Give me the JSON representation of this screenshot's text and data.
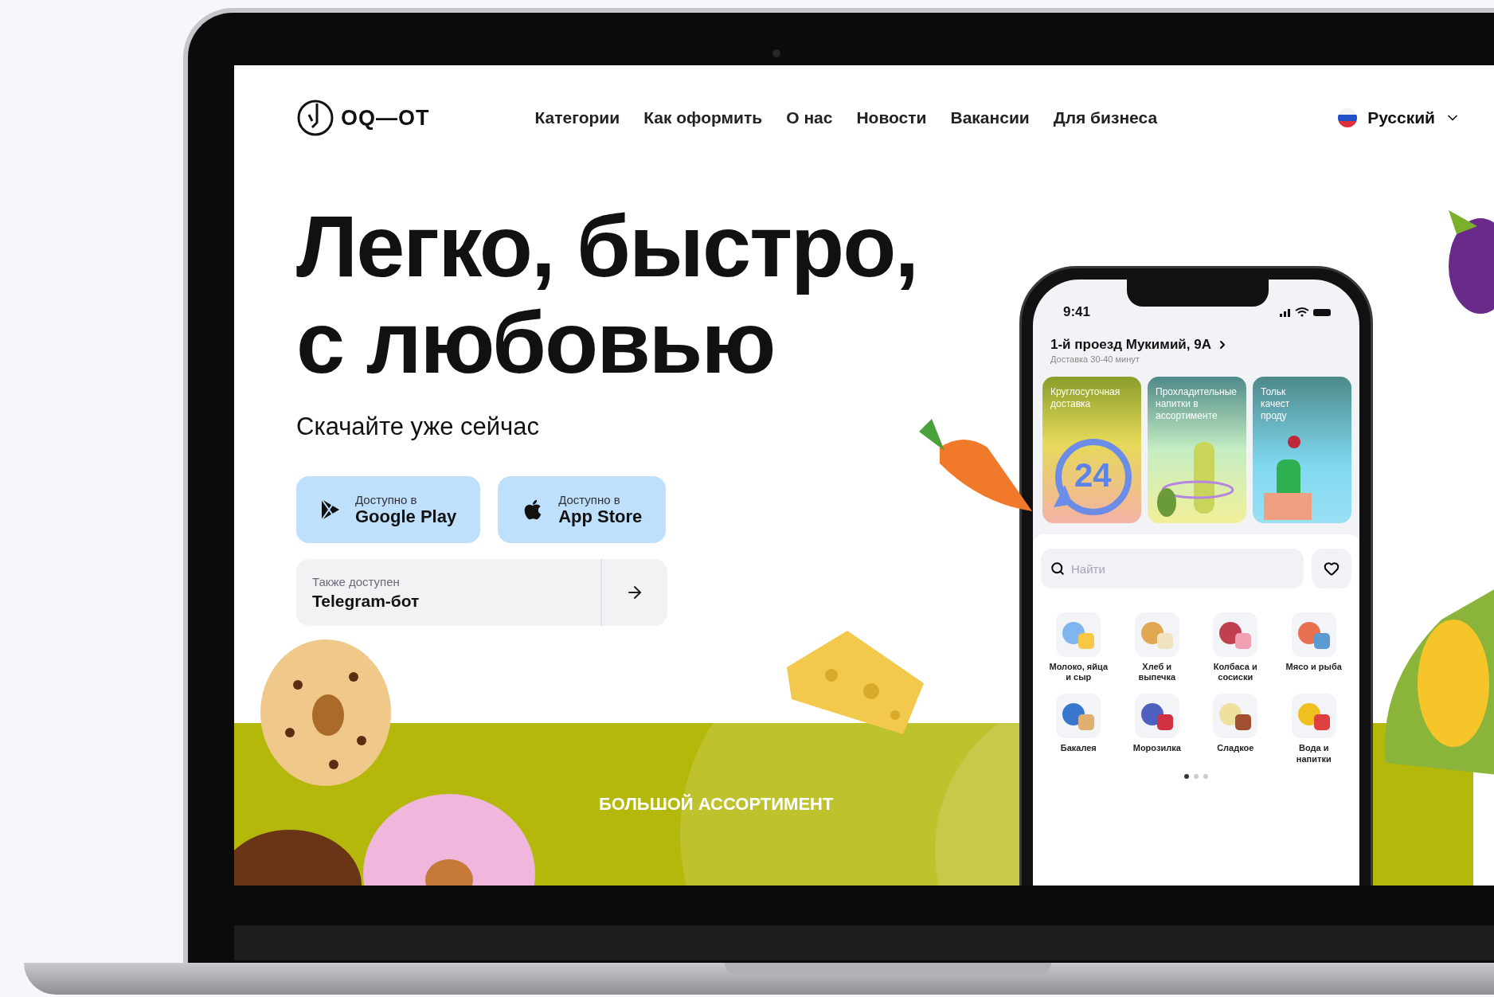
{
  "logo": {
    "text": "OQ—OT"
  },
  "nav": [
    {
      "label": "Категории"
    },
    {
      "label": "Как оформить"
    },
    {
      "label": "О нас"
    },
    {
      "label": "Новости"
    },
    {
      "label": "Вакансии"
    },
    {
      "label": "Для бизнеса"
    }
  ],
  "language": {
    "label": "Русский"
  },
  "hero": {
    "title_lines": [
      "Легко, быстро,",
      "с любовью"
    ],
    "subtitle": "Скачайте уже сейчас"
  },
  "store_buttons": [
    {
      "kind": "google",
      "caption": "Доступно в",
      "name": "Google Play"
    },
    {
      "kind": "apple",
      "caption": "Доступно в",
      "name": "App Store"
    }
  ],
  "telegram": {
    "caption": "Также доступен",
    "name": "Telegram-бот"
  },
  "banner": {
    "text": "БОЛЬШОЙ АССОРТИМЕНТ"
  },
  "phone": {
    "time": "9:41",
    "address": "1-й проезд Мукимий, 9А",
    "delivery": "Доставка 30-40 минут",
    "promos": [
      {
        "kind": "clock",
        "lines": [
          "Круглосуточная",
          "доставка"
        ],
        "art_text": "24"
      },
      {
        "kind": "drink",
        "lines": [
          "Прохладительные",
          "напитки в",
          "ассортименте"
        ]
      },
      {
        "kind": "grocery",
        "lines": [
          "Тольк",
          "качест",
          "проду"
        ]
      }
    ],
    "search": {
      "placeholder": "Найти"
    },
    "categories": [
      {
        "label": "Молоко, яйца и сыр"
      },
      {
        "label": "Хлеб и выпечка"
      },
      {
        "label": "Колбаса и сосиски"
      },
      {
        "label": "Мясо и рыба"
      },
      {
        "label": "Бакалея"
      },
      {
        "label": "Морозилка"
      },
      {
        "label": "Сладкое"
      },
      {
        "label": "Вода и напитки"
      }
    ],
    "pager": [
      {
        "selected": true
      },
      {
        "selected": false
      },
      {
        "selected": false
      }
    ]
  }
}
